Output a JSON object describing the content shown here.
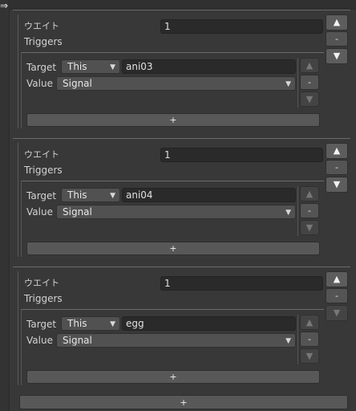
{
  "labels": {
    "weight": "ウエイト",
    "triggers": "Triggers",
    "target": "Target",
    "value": "Value"
  },
  "controls": {
    "up": "▲",
    "remove": "-",
    "down": "▼",
    "add": "+"
  },
  "elements": [
    {
      "weight_value": "1",
      "trigger": {
        "target_option": "This",
        "target_object": "ani03",
        "value_option": "Signal"
      }
    },
    {
      "weight_value": "1",
      "trigger": {
        "target_option": "This",
        "target_object": "ani04",
        "value_option": "Signal"
      }
    },
    {
      "weight_value": "1",
      "trigger": {
        "target_option": "This",
        "target_object": "egg",
        "value_option": "Signal"
      }
    }
  ],
  "bottom_add_button": "+"
}
